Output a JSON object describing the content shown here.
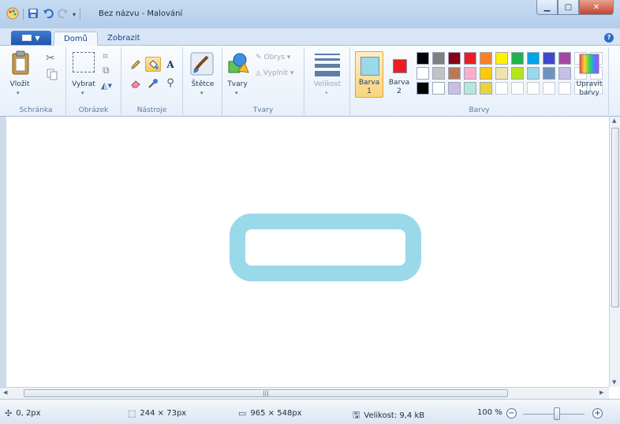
{
  "window": {
    "title": "Bez názvu - Malování"
  },
  "tabs": [
    {
      "label": "Domů",
      "active": true
    },
    {
      "label": "Zobrazit",
      "active": false
    }
  ],
  "ribbon": {
    "clipboard": {
      "group_label": "Schránka",
      "paste_label": "Vložit"
    },
    "image": {
      "group_label": "Obrázek",
      "select_label": "Vybrat"
    },
    "tools": {
      "group_label": "Nástroje",
      "text_glyph": "A"
    },
    "brushes": {
      "label": "Štětce"
    },
    "shapes": {
      "group_label": "Tvary",
      "shapes_label": "Tvary",
      "outline_label": "Obrys",
      "fill_label": "Vyplnit"
    },
    "size": {
      "label": "Velikost"
    },
    "colors": {
      "group_label": "Barvy",
      "color1_label": "Barva",
      "color1_num": "1",
      "color2_label": "Barva",
      "color2_num": "2",
      "color1_value": "#99d9ea",
      "color2_value": "#ed1c24",
      "edit_label_1": "Upravit",
      "edit_label_2": "barvy",
      "palette": [
        "#000000",
        "#7f7f7f",
        "#880015",
        "#ed1c24",
        "#ff7f27",
        "#fff200",
        "#22b14c",
        "#00a2e8",
        "#3f48cc",
        "#a349a4",
        "#ffffff",
        "#c3c3c3",
        "#b97a57",
        "#ffaec9",
        "#ffc90e",
        "#efe4b0",
        "#b5e61d",
        "#99d9ea",
        "#7092be",
        "#c8bfe7",
        "#000000",
        "#ffffff",
        "#c8bfe7",
        "#b5e8d8",
        "#e8d33e"
      ]
    }
  },
  "canvas": {
    "shape_color": "#99d9ea"
  },
  "status": {
    "cursor_pos": "0, 2px",
    "selection_size": "244 × 73px",
    "image_size": "965 × 548px",
    "file_size": "Velikost: 9,4 kB",
    "zoom": "100 %"
  }
}
